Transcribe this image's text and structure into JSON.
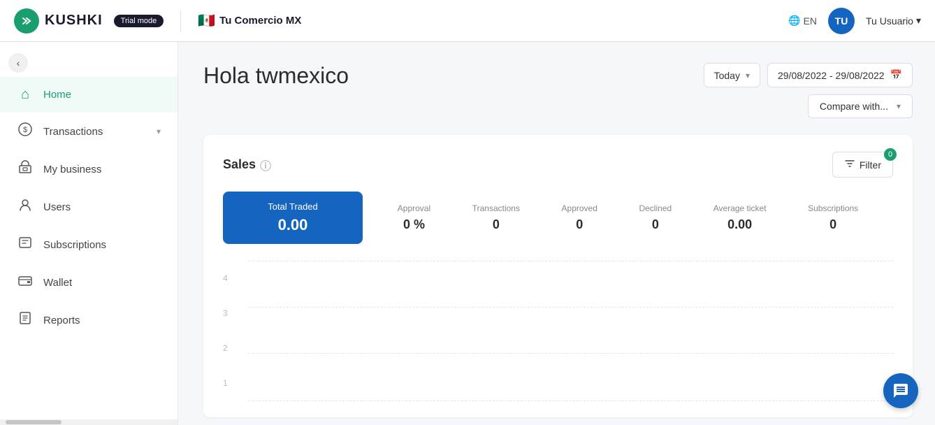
{
  "topbar": {
    "logo_text": "KUSHKI",
    "logo_initials": "K",
    "trial_badge": "Trial mode",
    "commerce_name": "Tu Comercio MX",
    "lang": "EN",
    "user_initials": "TU",
    "user_name": "Tu Usuario"
  },
  "sidebar": {
    "collapse_icon": "‹",
    "items": [
      {
        "id": "home",
        "label": "Home",
        "icon": "⌂",
        "active": true
      },
      {
        "id": "transactions",
        "label": "Transactions",
        "icon": "$",
        "has_chevron": true
      },
      {
        "id": "my-business",
        "label": "My business",
        "icon": "▦"
      },
      {
        "id": "users",
        "label": "Users",
        "icon": "👤"
      },
      {
        "id": "subscriptions",
        "label": "Subscriptions",
        "icon": "📊"
      },
      {
        "id": "wallet",
        "label": "Wallet",
        "icon": "💳"
      },
      {
        "id": "reports",
        "label": "Reports",
        "icon": "📋"
      }
    ]
  },
  "page": {
    "greeting": "Hola twmexico",
    "date_selector_label": "Today",
    "date_range": "29/08/2022 - 29/08/2022",
    "compare_label": "Compare with...",
    "sales_title": "Sales",
    "filter_label": "Filter",
    "filter_count": "0"
  },
  "stats": {
    "total_traded_label": "Total Traded",
    "total_traded_value": "0.00",
    "items": [
      {
        "label": "Approval",
        "value": "0 %"
      },
      {
        "label": "Transactions",
        "value": "0"
      },
      {
        "label": "Approved",
        "value": "0"
      },
      {
        "label": "Declined",
        "value": "0"
      },
      {
        "label": "Average ticket",
        "value": "0.00"
      },
      {
        "label": "Subscriptions",
        "value": "0"
      }
    ]
  },
  "chart": {
    "y_labels": [
      "1",
      "2",
      "3",
      "4"
    ]
  }
}
